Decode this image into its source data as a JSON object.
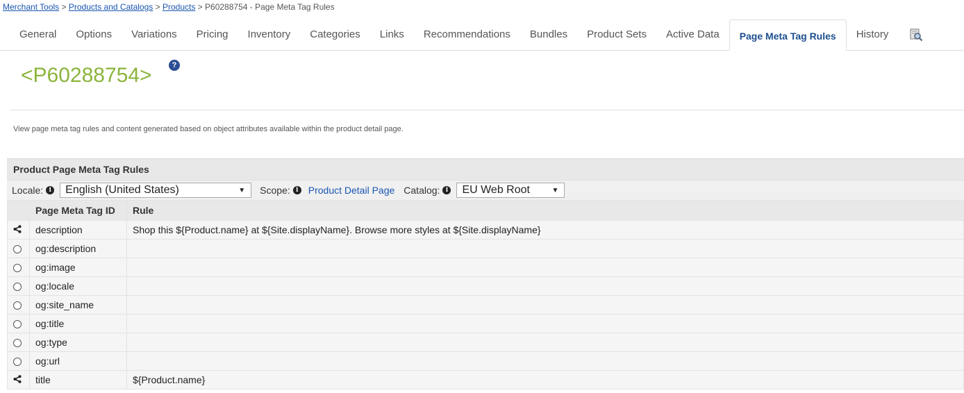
{
  "breadcrumb": {
    "items": [
      "Merchant Tools",
      "Products and Catalogs",
      "Products"
    ],
    "current": "P60288754 - Page Meta Tag Rules",
    "separator": ">"
  },
  "tabs": [
    {
      "label": "General"
    },
    {
      "label": "Options"
    },
    {
      "label": "Variations"
    },
    {
      "label": "Pricing"
    },
    {
      "label": "Inventory"
    },
    {
      "label": "Categories"
    },
    {
      "label": "Links"
    },
    {
      "label": "Recommendations"
    },
    {
      "label": "Bundles"
    },
    {
      "label": "Product Sets"
    },
    {
      "label": "Active Data"
    },
    {
      "label": "Page Meta Tag Rules",
      "active": true
    },
    {
      "label": "History"
    }
  ],
  "tab_icon": "preview-icon",
  "page_title": "<P60288754>",
  "help_icon_glyph": "?",
  "description": "View page meta tag rules and content generated based on object attributes available within the product detail page.",
  "panel": {
    "title": "Product Page Meta Tag Rules",
    "locale_label": "Locale:",
    "locale_value": "English (United States)",
    "scope_label": "Scope:",
    "scope_value": "Product Detail Page",
    "catalog_label": "Catalog:",
    "catalog_value": "EU Web Root",
    "info_glyph": "i"
  },
  "table": {
    "columns": [
      "",
      "Page Meta Tag ID",
      "Rule"
    ],
    "rows": [
      {
        "icon": "share-icon",
        "id": "description",
        "rule": "Shop this ${Product.name} at ${Site.displayName}. Browse more styles at ${Site.displayName}"
      },
      {
        "icon": "radio-icon",
        "id": "og:description",
        "rule": ""
      },
      {
        "icon": "radio-icon",
        "id": "og:image",
        "rule": ""
      },
      {
        "icon": "radio-icon",
        "id": "og:locale",
        "rule": ""
      },
      {
        "icon": "radio-icon",
        "id": "og:site_name",
        "rule": ""
      },
      {
        "icon": "radio-icon",
        "id": "og:title",
        "rule": ""
      },
      {
        "icon": "radio-icon",
        "id": "og:type",
        "rule": ""
      },
      {
        "icon": "radio-icon",
        "id": "og:url",
        "rule": ""
      },
      {
        "icon": "share-icon",
        "id": "title",
        "rule": "${Product.name}"
      }
    ]
  },
  "colors": {
    "title_green": "#8cb43c",
    "link_blue": "#1a55b0",
    "active_tab_text": "#1c4f8e",
    "header_gray": "#e8e8e8"
  }
}
